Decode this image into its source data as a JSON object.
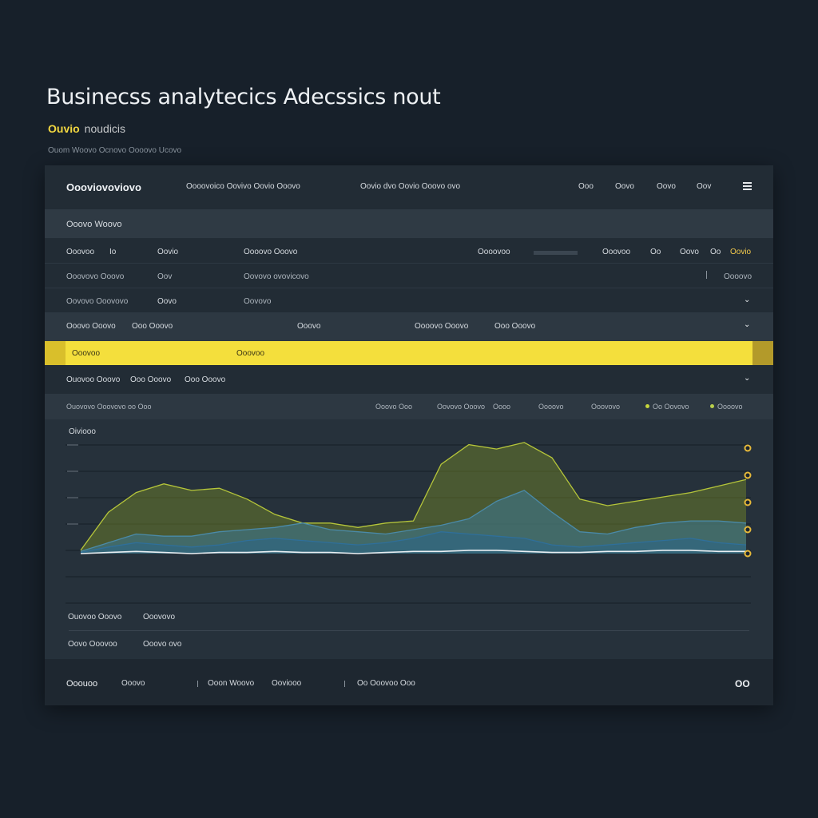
{
  "page": {
    "title": "Businecss analytecics Adecssics nout",
    "subtitle_accent": "Ouvio",
    "subtitle_rest": "noudicis",
    "meta": "Ouom Woovo Ocnovo Oooovo Ucovo"
  },
  "header": {
    "brand": "Oooviovoviovo",
    "nav": [
      "Oooovoico Oovivo Oovio Ooovo",
      "Oovio dvo Oovio Ooovo ovo"
    ],
    "items": [
      "Ooo",
      "Oovo",
      "Oovo",
      "Oov"
    ]
  },
  "section": {
    "title": "Ooovo Woovo"
  },
  "table_rows": [
    {
      "c1": "Ooovoo",
      "c1b": "Io",
      "c2": "Oovio",
      "c3": "Oooovo Ooovo",
      "c4": "Oooovoo",
      "c5": "Ooovoo",
      "c6": "Oo",
      "c7": "Oovo",
      "c8": "Oo",
      "c9": "Oovio"
    },
    {
      "c1": "Ooovovo Ooovo",
      "c2": "Oov",
      "c3": "Oovovo ovovicovo",
      "c4": "Oooovo"
    },
    {
      "c1": "Oovovo Ooovovo",
      "c2": "Oovo",
      "c3": "Oovovo"
    }
  ],
  "filter_row": {
    "f1": "Ooovo Ooovo",
    "f2": "Ooo Ooovo",
    "f3": "Ooovo",
    "f4": "Oooovo Ooovo",
    "f5": "Ooo Ooovo"
  },
  "highlight_row": {
    "left": "Ooovoo",
    "right": "Ooovoo"
  },
  "dropdown_row": {
    "d1": "Ouovoo Ooovo",
    "d2": "Ooo Ooovo",
    "d3": "Ooo Ooovo"
  },
  "legend_row": {
    "left": "Ouovovo Ooovovo oo Ooo",
    "items": [
      "Ooovo Ooo",
      "Oovovo Ooovo",
      "Oooo",
      "Oooovo",
      "Ooovovo"
    ],
    "series1": "Oo Oovovo",
    "series2": "Oooovo"
  },
  "chart_data": {
    "type": "area",
    "title": "Oiviooo",
    "x": [
      0,
      1,
      2,
      3,
      4,
      5,
      6,
      7,
      8,
      9,
      10,
      11,
      12,
      13,
      14,
      15,
      16,
      17,
      18,
      19,
      20,
      21,
      22,
      23,
      24
    ],
    "series": [
      {
        "values": [
          3,
          38,
          56,
          64,
          58,
          60,
          50,
          36,
          28,
          28,
          24,
          28,
          30,
          82,
          100,
          96,
          102,
          88,
          50,
          44,
          48,
          52,
          56,
          62,
          68
        ]
      },
      {
        "values": [
          2,
          10,
          18,
          16,
          16,
          20,
          22,
          24,
          28,
          22,
          20,
          18,
          22,
          26,
          32,
          48,
          58,
          38,
          20,
          18,
          24,
          28,
          30,
          30,
          28
        ]
      },
      {
        "values": [
          1,
          6,
          10,
          8,
          6,
          8,
          12,
          14,
          12,
          10,
          8,
          10,
          14,
          20,
          18,
          16,
          14,
          8,
          6,
          8,
          10,
          12,
          14,
          10,
          8
        ]
      },
      {
        "values": [
          0,
          1,
          2,
          1,
          0,
          1,
          1,
          2,
          1,
          1,
          0,
          1,
          2,
          2,
          3,
          3,
          2,
          1,
          1,
          2,
          2,
          3,
          3,
          2,
          2
        ]
      }
    ],
    "ylim": [
      0,
      110
    ],
    "grid": true,
    "colors": [
      "#b5c53a",
      "#4a8aa8",
      "#2f6f9a",
      "#e9eef2"
    ]
  },
  "footer": {
    "row1_a": "Ouovoo Ooovo",
    "row1_b": "Ooovovo",
    "row2_a": "Oovo Ooovoo",
    "row2_b": "Ooovo ovo",
    "bottom_a": "Ooouoo",
    "bottom_a2": "Ooovo",
    "bottom_b": "Ooon Woovo",
    "bottom_c": "Ooviooo",
    "bottom_d": "Oo Ooovoo Ooo",
    "bottom_right": "OO"
  },
  "colors": {
    "accent": "#f4df3c",
    "background": "#17202a",
    "panel": "#232d36"
  }
}
